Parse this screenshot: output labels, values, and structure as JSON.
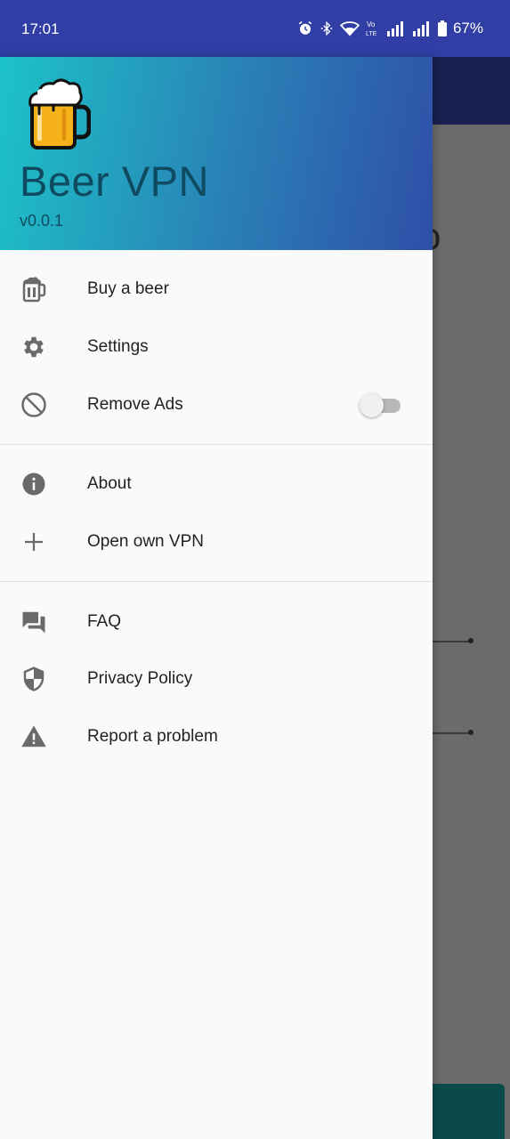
{
  "status_bar": {
    "time": "17:01",
    "battery_percent": "67%",
    "icons": [
      "alarm-icon",
      "bluetooth-icon",
      "wifi-icon",
      "volte-icon",
      "signal-icon",
      "signal-icon",
      "battery-icon"
    ],
    "volte_label": "Vo LTE"
  },
  "header": {
    "app_name": "Beer VPN",
    "version": "v0.0.1",
    "logo": "beer-mug-logo",
    "gradient_colors": [
      "#1dc3c8",
      "#2f4fa8"
    ]
  },
  "menu": {
    "buy_beer": {
      "label": "Buy a beer",
      "icon": "beer-icon"
    },
    "settings": {
      "label": "Settings",
      "icon": "gear-icon"
    },
    "remove_ads": {
      "label": "Remove Ads",
      "icon": "block-icon",
      "toggle_on": false
    },
    "about": {
      "label": "About",
      "icon": "info-icon"
    },
    "open_vpn": {
      "label": "Open own VPN",
      "icon": "plus-icon"
    },
    "faq": {
      "label": "FAQ",
      "icon": "forum-icon"
    },
    "privacy": {
      "label": "Privacy Policy",
      "icon": "shield-icon"
    },
    "report": {
      "label": "Report a problem",
      "icon": "warning-icon"
    }
  },
  "background_app": {
    "partial_letter": "o"
  }
}
